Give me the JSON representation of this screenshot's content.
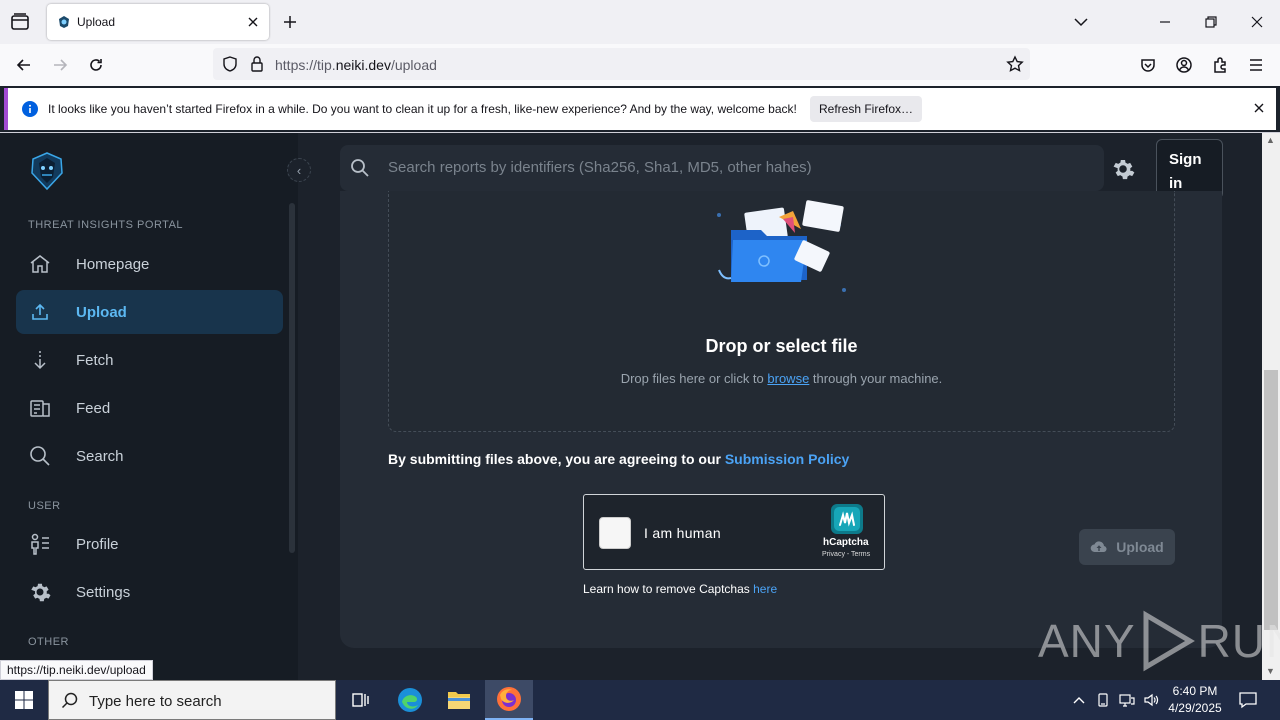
{
  "browser": {
    "tab_title": "Upload",
    "url_prefix": "https://tip.",
    "url_host": "neiki.dev",
    "url_path": "/upload",
    "notification_text": "It looks like you haven’t started Firefox in a while. Do you want to clean it up for a fresh, like-new experience? And by the way, welcome back!",
    "notification_button": "Refresh Firefox…",
    "status_url": "https://tip.neiki.dev/upload"
  },
  "sidebar": {
    "section_main": "THREAT INSIGHTS PORTAL",
    "items": [
      {
        "label": "Homepage",
        "icon": "home-icon"
      },
      {
        "label": "Upload",
        "icon": "upload-icon",
        "active": true
      },
      {
        "label": "Fetch",
        "icon": "fetch-icon"
      },
      {
        "label": "Feed",
        "icon": "feed-icon"
      },
      {
        "label": "Search",
        "icon": "search-icon"
      }
    ],
    "section_user": "USER",
    "user_items": [
      {
        "label": "Profile",
        "icon": "profile-icon"
      },
      {
        "label": "Settings",
        "icon": "gear-icon"
      }
    ],
    "section_other": "OTHER"
  },
  "header": {
    "search_placeholder": "Search reports by identifiers (Sha256, Sha1, MD5, other hahes)",
    "signin_label": "Sign in"
  },
  "upload": {
    "drop_title": "Drop or select file",
    "drop_sub_before": "Drop files here or click to ",
    "drop_sub_link": "browse",
    "drop_sub_after": " through your machine.",
    "policy_text": "By submitting files above, you are agreeing to our ",
    "policy_link": "Submission Policy",
    "captcha_label": "I am human",
    "captcha_brand": "hCaptcha",
    "captcha_links": "Privacy - Terms",
    "captcha_help": "Learn how to remove Captchas ",
    "captcha_help_link": "here",
    "upload_button": "Upload"
  },
  "watermark": {
    "left": "ANY",
    "right": "RUN"
  },
  "taskbar": {
    "search_placeholder": "Type here to search",
    "time": "6:40 PM",
    "date": "4/29/2025"
  },
  "colors": {
    "accent": "#4ba3f5",
    "active_nav_bg": "#18344c",
    "sidebar_bg": "#161c24",
    "card_bg": "#252c36"
  }
}
